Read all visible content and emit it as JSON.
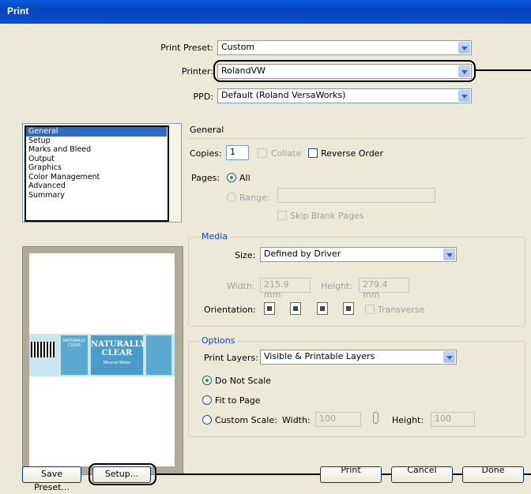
{
  "window": {
    "title": "Print"
  },
  "print_preset": {
    "label": "Print Preset:",
    "value": "Custom"
  },
  "printer": {
    "label": "Printer:",
    "value": "RolandVW"
  },
  "ppd": {
    "label": "PPD:",
    "value": "Default (Roland VersaWorks)"
  },
  "sections": [
    "General",
    "Setup",
    "Marks and Bleed",
    "Output",
    "Graphics",
    "Color Management",
    "Advanced",
    "Summary"
  ],
  "general": {
    "heading": "General",
    "copies_label": "Copies:",
    "copies_value": "1",
    "collate": "Collate",
    "reverse_order": "Reverse Order",
    "pages_label": "Pages:",
    "all": "All",
    "range": "Range:",
    "skip_blank": "Skip Blank Pages"
  },
  "media": {
    "title": "Media",
    "size_label": "Size:",
    "size_value": "Defined by Driver",
    "width_label": "Width:",
    "width_value": "215.9 mm",
    "height_label": "Height:",
    "height_value": "279.4 mm",
    "orientation_label": "Orientation:",
    "transverse": "Transverse"
  },
  "options": {
    "title": "Options",
    "print_layers_label": "Print Layers:",
    "print_layers_value": "Visible & Printable Layers",
    "do_not_scale": "Do Not Scale",
    "fit_to_page": "Fit to Page",
    "custom_scale": "Custom Scale:",
    "width_label": "Width:",
    "width_value": "100",
    "height_label": "Height:",
    "height_value": "100"
  },
  "preview": {
    "brand_main": "NATURALLY",
    "brand_sub": "CLEAR",
    "small_brand_main": "NATURALLY",
    "small_brand_sub": "CLEAR",
    "product": "Mineral Water"
  },
  "buttons": {
    "save_preset": "Save Preset...",
    "setup": "Setup...",
    "print": "Print",
    "cancel": "Cancel",
    "done": "Done"
  }
}
